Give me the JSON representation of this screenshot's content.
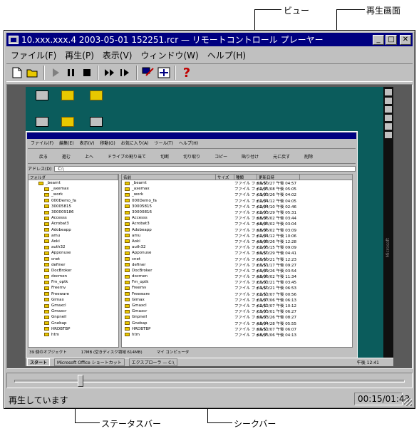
{
  "annotations": {
    "view": "ビュー",
    "playback_screen": "再生画面",
    "status_bar": "ステータスバー",
    "seek_bar": "シークバー"
  },
  "window": {
    "title": "10.xxx.xxx.4 2003-05-01 152251.rcr — リモートコントロール プレーヤー",
    "min": "_",
    "max": "□",
    "close": "✕"
  },
  "menu": [
    "ファイル(F)",
    "再生(P)",
    "表示(V)",
    "ウィンドウ(W)",
    "ヘルプ(H)"
  ],
  "toolbar": {
    "icons": [
      "new-icon",
      "open-icon",
      "play-icon",
      "pause-icon",
      "stop-icon",
      "fast-forward-icon",
      "step-icon",
      "connect-icon",
      "fit-icon",
      "help-icon"
    ],
    "help_glyph": "?"
  },
  "remote": {
    "explorer_menu": [
      "ファイル(F)",
      "編集(E)",
      "表示(V)",
      "移動(G)",
      "お気に入り(A)",
      "ツール(T)",
      "ヘルプ(H)"
    ],
    "explorer_tools": [
      "戻る",
      "進む",
      "上へ",
      "ドライブの割り当て",
      "切断",
      "切り取り",
      "コピー",
      "貼り付け",
      "元に戻す",
      "削除"
    ],
    "address_label": "アドレス(D)",
    "address_value": "C:\\",
    "tree_header": "フォルダ",
    "tree_items": [
      "_bearnt",
      "_axemax",
      "_work",
      "000Demo_fa",
      "30005815",
      "300009186",
      "Accesss",
      "Acrobat3",
      "Adobeapp",
      "amu",
      "Aoki",
      "auth32",
      "Apponuse",
      "cnet",
      "definer",
      "DocBroker",
      "docmen",
      "Fm_optk",
      "Freemv",
      "Freeware",
      "Gimax",
      "Gmaxcl",
      "Gmaxcr",
      "Gnpneil",
      "Gnebap",
      "HRDBTBP",
      "htm"
    ],
    "list_headers": [
      "名前",
      "サイズ",
      "種類",
      "更新日時"
    ],
    "list_rows": [
      [
        "_bearnt",
        "ファイル フォルダ",
        "99/10/27 午後 04:57"
      ],
      [
        "_axemax",
        "ファイル フォルダ",
        "02/05/08 午後 05:05"
      ],
      [
        "_work",
        "ファイル フォルダ",
        "01/03/26 午後 04:02"
      ],
      [
        "000Demo_fa",
        "ファイル フォルダ",
        "02/04/12 午後 04:05"
      ],
      [
        "30005815",
        "ファイル フォルダ",
        "02/04/10 午後 02:46"
      ],
      [
        "30000816",
        "ファイル フォルダ",
        "02/03/29 午後 05:31"
      ],
      [
        "Accesss",
        "ファイル フォルダ",
        "98/06/02 午後 03:44"
      ],
      [
        "Acrobat3",
        "ファイル フォルダ",
        "98/06/02 午後 03:04"
      ],
      [
        "Adobeapp",
        "ファイル フォルダ",
        "98/06/02 午後 03:09"
      ],
      [
        "amu",
        "ファイル フォルダ",
        "02/04/12 午後 10:06"
      ],
      [
        "Aoki",
        "ファイル フォルダ",
        "99/08/26 午後 12:28"
      ],
      [
        "auth32",
        "ファイル フォルダ",
        "02/05/15 午後 09:09"
      ],
      [
        "Apponuse",
        "ファイル フォルダ",
        "99/10/29 午後 04:41"
      ],
      [
        "cnet",
        "ファイル フォルダ",
        "00/10/21 午後 12:23"
      ],
      [
        "definer",
        "ファイル フォルダ",
        "00/11/17 午後 09:27"
      ],
      [
        "DocBroker",
        "ファイル フォルダ",
        "00/09/26 午後 03:54"
      ],
      [
        "docmen",
        "ファイル フォルダ",
        "98/06/02 午後 11:34"
      ],
      [
        "Fm_optk",
        "ファイル フォルダ",
        "00/02/21 午後 03:45"
      ],
      [
        "Freemv",
        "ファイル フォルダ",
        "01/10/21 午後 06:53"
      ],
      [
        "Freeware",
        "ファイル フォルダ",
        "02/12/07 午後 00:56"
      ],
      [
        "Gimax",
        "ファイル フォルダ",
        "01/07/06 午後 06:13"
      ],
      [
        "Gmaxcl",
        "ファイル フォルダ",
        "02/12/07 午後 10:12"
      ],
      [
        "Gmaxcr",
        "ファイル フォルダ",
        "03/03/01 午後 06:27"
      ],
      [
        "Gnpneil",
        "ファイル フォルダ",
        "99/03/26 午後 08:27"
      ],
      [
        "Gnebap",
        "ファイル フォルダ",
        "98/04/28 午後 05:55"
      ],
      [
        "HRDBTBP",
        "ファイル フォルダ",
        "99/12/07 午後 06:07"
      ],
      [
        "htm",
        "ファイル フォルダ",
        "98/05/06 午後 04:13"
      ]
    ],
    "explorer_status": [
      "39 個のオブジェクト",
      "17MB (空きディスク領域 614MB)",
      "マイ コンピュータ"
    ],
    "taskbar": [
      "スタート",
      "Microsoft Office ショートカット",
      "エクスプローラ — C:\\",
      "午後 12:41"
    ],
    "side_label": "Microsoft"
  },
  "seek": {
    "position_fraction": 0.17
  },
  "status": {
    "text": "再生しています",
    "time": "00:15/01:43"
  }
}
